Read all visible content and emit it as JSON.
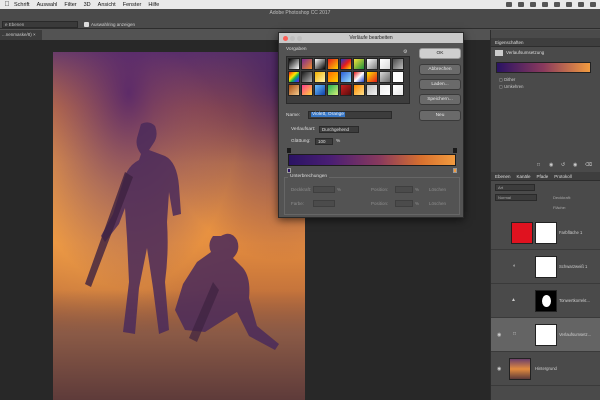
{
  "menubar": {
    "items": [
      "Schrift",
      "Auswahl",
      "Filter",
      "3D",
      "Ansicht",
      "Fenster",
      "Hilfe"
    ]
  },
  "optionsbar": {
    "app_title": "Adobe Photoshop CC 2017",
    "tool_select": "e Ebenen",
    "checkbox_label": "Auswahlring anzeigen"
  },
  "document": {
    "tab_label": "...nenmaske/8) ×"
  },
  "dialog": {
    "title": "Verläufe bearbeiten",
    "presets_label": "Vorgaben",
    "buttons": {
      "ok": "OK",
      "cancel": "Abbrechen",
      "load": "Laden...",
      "save": "Speichern...",
      "new": "Neu"
    },
    "name_label": "Name:",
    "name_value": "Violett, Orange",
    "type_label": "Verlaufsart:",
    "type_value": "Durchgehend",
    "smooth_label": "Glättung:",
    "smooth_value": "100",
    "smooth_unit": "%",
    "stops_group_label": "Unterbrechungen",
    "opacity_label": "Deckkraft:",
    "position_label": "Position:",
    "delete_label": "Löschen",
    "color_label": "Farbe:",
    "pct": "%",
    "preset_colors": [
      [
        "#000000",
        "#ffffff"
      ],
      [
        "#7d2d8f",
        "#f08b2b"
      ],
      [
        "#ffffff",
        "#000000"
      ],
      [
        "#e51b1b",
        "#ffd500"
      ],
      [
        "#1d3cc9",
        "#e51b1b",
        "#ffd500"
      ],
      [
        "#f9e33b",
        "#1a8e3a"
      ],
      [
        "#ffffff",
        "#7a7a7a"
      ],
      [
        "#ffffff",
        "#d8d8d8"
      ],
      [
        "#4a4a4a",
        "#bdbdbd"
      ],
      [
        "#e51b1b",
        "#ff9100",
        "#ffe600",
        "#17b34d",
        "#1658d8",
        "#8b20c9"
      ],
      [
        "#1a1a1a",
        "#b0b0b0"
      ],
      [
        "#f2b200",
        "#fff3b0"
      ],
      [
        "#ff6a00",
        "#ffd200"
      ],
      [
        "#2b5fd8",
        "#9be0ff"
      ],
      [
        "#e51b1b",
        "#ffffff",
        "#1d3cc9"
      ],
      [
        "#ffe600",
        "#e51b1b"
      ],
      [
        "#d8d8d8",
        "#6a6a6a"
      ],
      [
        "#ffffff",
        "#ffffff"
      ],
      [
        "#a64c12",
        "#f5c98b"
      ],
      [
        "#ff3d8b",
        "#ffd43b"
      ],
      [
        "#6cc2ff",
        "#0d3fa8"
      ],
      [
        "#1fae52",
        "#d7f27a"
      ],
      [
        "#c72020",
        "#5a0a0a"
      ],
      [
        "#ff8a00",
        "#ffe08a"
      ],
      [
        "#bcbcbc",
        "#f4f4f4"
      ],
      [
        "#eeeeee",
        "#ffffff"
      ],
      [
        "#ffffff",
        "#e8e8e8"
      ]
    ]
  },
  "properties_panel": {
    "tab_label": "Eigenschaften",
    "subtitle": "Verlaufsumsetzung",
    "dither_label": "Dither",
    "reverse_label": "Umkehren"
  },
  "layers_panel": {
    "tabs": [
      "Ebenen",
      "Kanäle",
      "Pfade",
      "Protokoll"
    ],
    "search_placeholder": "Art",
    "blend_mode": "Normal",
    "opacity_label": "Deckkraft:",
    "fill_label": "Fläche:",
    "layers": [
      {
        "name": "Farbfläche 1",
        "thumb": "#e0121f"
      },
      {
        "name": "Schwarzweiß 1",
        "thumb": "#ffffff"
      },
      {
        "name": "Tonwertkorrekt...",
        "thumb": "#000000"
      },
      {
        "name": "Verlaufsumsetz...",
        "thumb": "#ffffff"
      },
      {
        "name": "Hintergrund",
        "thumb": "#d48a46"
      }
    ]
  }
}
